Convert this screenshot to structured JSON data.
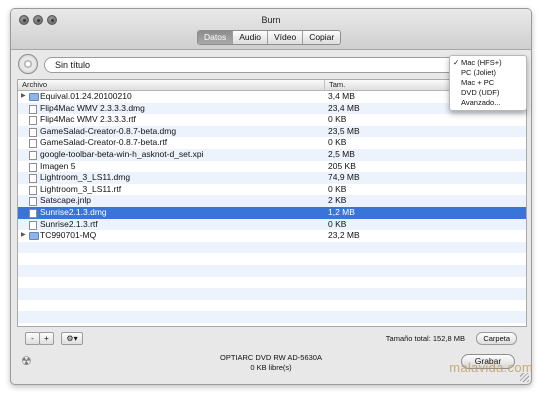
{
  "window": {
    "title": "Burn"
  },
  "tabs": [
    {
      "label": "Datos",
      "active": true
    },
    {
      "label": "Audio",
      "active": false
    },
    {
      "label": "Vídeo",
      "active": false
    },
    {
      "label": "Copiar",
      "active": false
    }
  ],
  "disc_title": {
    "value": "Sin título"
  },
  "format_menu": {
    "items": [
      {
        "label": "Mac (HFS+)",
        "checked": true
      },
      {
        "label": "PC (Joliet)",
        "checked": false
      },
      {
        "label": "Mac + PC",
        "checked": false
      },
      {
        "label": "DVD (UDF)",
        "checked": false
      },
      {
        "label": "Avanzado...",
        "checked": false
      }
    ]
  },
  "file_list": {
    "columns": {
      "name": "Archivo",
      "size": "Tam."
    },
    "rows": [
      {
        "name": "Equival.01.24.20100210",
        "size": "3,4 MB",
        "type": "folder",
        "expandable": true,
        "selected": false
      },
      {
        "name": "Flip4Mac WMV 2.3.3.3.dmg",
        "size": "23,4 MB",
        "type": "file",
        "expandable": false,
        "selected": false
      },
      {
        "name": "Flip4Mac WMV 2.3.3.3.rtf",
        "size": "0 KB",
        "type": "file",
        "expandable": false,
        "selected": false
      },
      {
        "name": "GameSalad-Creator-0.8.7-beta.dmg",
        "size": "23,5 MB",
        "type": "file",
        "expandable": false,
        "selected": false
      },
      {
        "name": "GameSalad-Creator-0.8.7-beta.rtf",
        "size": "0 KB",
        "type": "file",
        "expandable": false,
        "selected": false
      },
      {
        "name": "google-toolbar-beta-win-h_asknot-d_set.xpi",
        "size": "2,5 MB",
        "type": "file",
        "expandable": false,
        "selected": false
      },
      {
        "name": "Imagen 5",
        "size": "205 KB",
        "type": "file",
        "expandable": false,
        "selected": false
      },
      {
        "name": "Lightroom_3_LS11.dmg",
        "size": "74,9 MB",
        "type": "file",
        "expandable": false,
        "selected": false
      },
      {
        "name": "Lightroom_3_LS11.rtf",
        "size": "0 KB",
        "type": "file",
        "expandable": false,
        "selected": false
      },
      {
        "name": "Satscape.jnlp",
        "size": "2 KB",
        "type": "file",
        "expandable": false,
        "selected": false
      },
      {
        "name": "Sunrise2.1.3.dmg",
        "size": "1,2 MB",
        "type": "file",
        "expandable": false,
        "selected": true
      },
      {
        "name": "Sunrise2.1.3.rtf",
        "size": "0 KB",
        "type": "file",
        "expandable": false,
        "selected": false
      },
      {
        "name": "TC990701-MQ",
        "size": "23,2 MB",
        "type": "folder",
        "expandable": true,
        "selected": false
      }
    ]
  },
  "bottom_bar": {
    "remove_label": "-",
    "add_label": "+",
    "gear_label": "⚙▾",
    "total_label": "Tamaño total: 152,8 MB",
    "folder_button": "Carpeta"
  },
  "footer": {
    "drive_name": "OPTIARC DVD RW AD-5630A",
    "free_space": "0 KB libre(s)",
    "burn_button": "Grabar"
  },
  "watermark": "malavida.com"
}
